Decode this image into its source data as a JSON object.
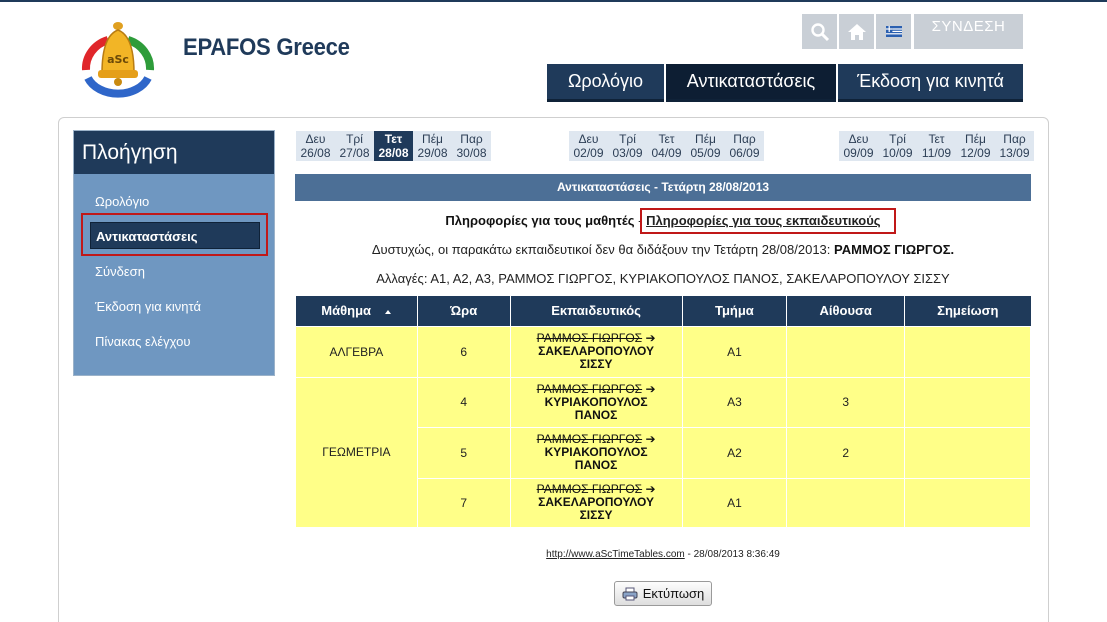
{
  "header": {
    "site_title": "EPAFOS Greece",
    "login_label": "ΣΥΝΔΕΣΗ",
    "nav": [
      "Ωρολόγιο",
      "Αντικαταστάσεις",
      "Έκδοση για κινητά"
    ],
    "colors": {
      "brand": "#1f3a5a",
      "highlight": "#ffff88",
      "accent_red": "#c01818"
    }
  },
  "sidebar": {
    "title": "Πλοήγηση",
    "items": [
      "Ωρολόγιο",
      "Αντικαταστάσεις",
      "Σύνδεση",
      "Έκδοση για κινητά",
      "Πίνακας ελέγχου"
    ]
  },
  "days": [
    {
      "name": "Δευ",
      "date": "26/08"
    },
    {
      "name": "Τρί",
      "date": "27/08"
    },
    {
      "name": "Τετ",
      "date": "28/08"
    },
    {
      "name": "Πέμ",
      "date": "29/08"
    },
    {
      "name": "Παρ",
      "date": "30/08"
    },
    {
      "name": "Δευ",
      "date": "02/09"
    },
    {
      "name": "Τρί",
      "date": "03/09"
    },
    {
      "name": "Τετ",
      "date": "04/09"
    },
    {
      "name": "Πέμ",
      "date": "05/09"
    },
    {
      "name": "Παρ",
      "date": "06/09"
    },
    {
      "name": "Δευ",
      "date": "09/09"
    },
    {
      "name": "Τρί",
      "date": "10/09"
    },
    {
      "name": "Τετ",
      "date": "11/09"
    },
    {
      "name": "Πέμ",
      "date": "12/09"
    },
    {
      "name": "Παρ",
      "date": "13/09"
    }
  ],
  "content": {
    "title": "Αντικαταστάσεις - Τετάρτη 28/08/2013",
    "students_info": "Πληροφορίες για τους μαθητές",
    "separator": "-",
    "teachers_info": "Πληροφορίες για τους εκπαιδευτικούς",
    "absent_text": "Δυστυχώς, οι παρακάτω εκπαιδευτικοί δεν θα διδάξουν την Τετάρτη 28/08/2013:",
    "absent_names": "ΡΑΜΜΟΣ ΓΙΩΡΓΟΣ.",
    "changes": "Αλλαγές: Α1, Α2, Α3, ΡΑΜΜΟΣ ΓΙΩΡΓΟΣ, ΚΥΡΙΑΚΟΠΟΥΛΟΣ ΠΑΝΟΣ, ΣΑΚΕΛΑΡΟΠΟΥΛΟΥ ΣΙΣΣΥ"
  },
  "table": {
    "columns": [
      "Μάθημα",
      "Ώρα",
      "Εκπαιδευτικός",
      "Τμήμα",
      "Αίθουσα",
      "Σημείωση"
    ],
    "subject_1": "ΑΛΓΕΒΡΑ",
    "subject_2": "ΓΕΩΜΕΤΡΙΑ",
    "rows": [
      {
        "hour": "6",
        "old_teacher": "ΡΑΜΜΟΣ ΓΙΩΡΓΟΣ",
        "arrow": "➔",
        "new_teacher_1": "ΣΑΚΕΛΑΡΟΠΟΥΛΟΥ",
        "new_teacher_2": "ΣΙΣΣΥ",
        "class": "Α1",
        "room": "",
        "note": ""
      },
      {
        "hour": "4",
        "old_teacher": "ΡΑΜΜΟΣ ΓΙΩΡΓΟΣ",
        "arrow": "➔",
        "new_teacher_1": "ΚΥΡΙΑΚΟΠΟΥΛΟΣ",
        "new_teacher_2": "ΠΑΝΟΣ",
        "class": "Α3",
        "room": "3",
        "note": ""
      },
      {
        "hour": "5",
        "old_teacher": "ΡΑΜΜΟΣ ΓΙΩΡΓΟΣ",
        "arrow": "➔",
        "new_teacher_1": "ΚΥΡΙΑΚΟΠΟΥΛΟΣ",
        "new_teacher_2": "ΠΑΝΟΣ",
        "class": "Α2",
        "room": "2",
        "note": ""
      },
      {
        "hour": "7",
        "old_teacher": "ΡΑΜΜΟΣ ΓΙΩΡΓΟΣ",
        "arrow": "➔",
        "new_teacher_1": "ΣΑΚΕΛΑΡΟΠΟΥΛΟΥ",
        "new_teacher_2": "ΣΙΣΣΥ",
        "class": "Α1",
        "room": "",
        "note": ""
      }
    ]
  },
  "footer": {
    "link": "http://www.aScTimeTables.com",
    "timestamp": "- 28/08/2013 8:36:49"
  },
  "print_label": "Εκτύπωση",
  "icons": {
    "search": "search-icon",
    "home": "home-icon",
    "flag": "greek-flag-icon",
    "printer": "printer-icon",
    "logo": "bell-logo-icon"
  }
}
